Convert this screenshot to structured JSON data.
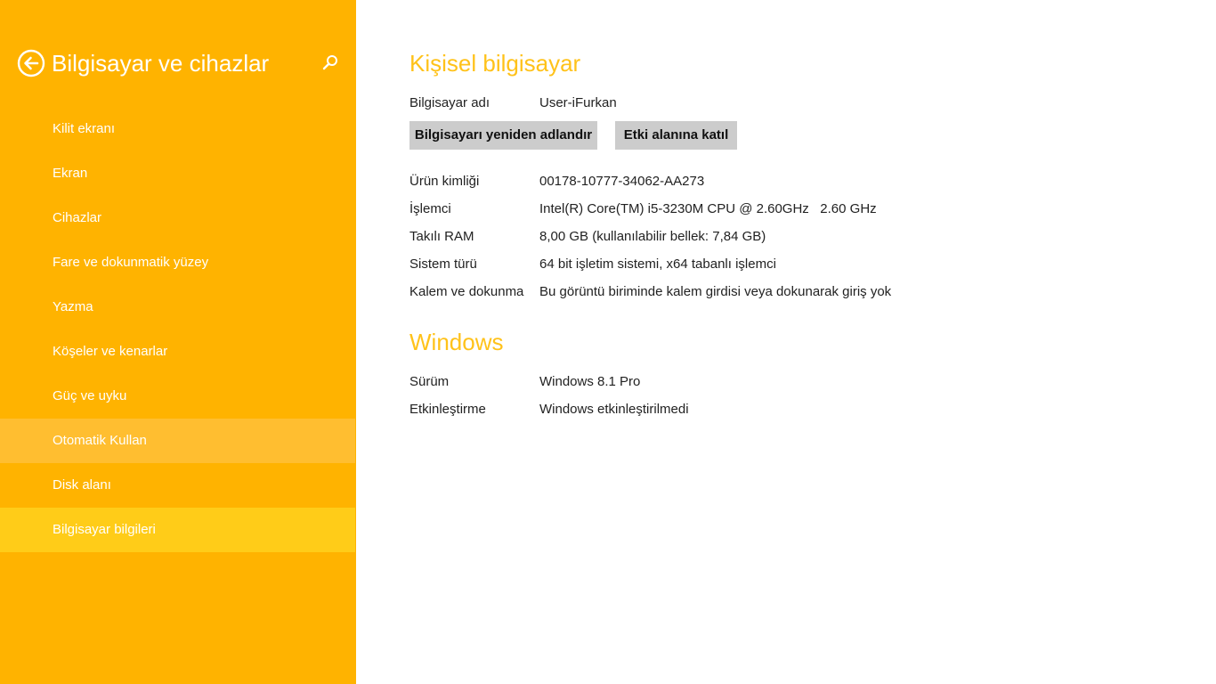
{
  "sidebar": {
    "title": "Bilgisayar ve cihazlar",
    "back_icon": "back-arrow-circle-icon",
    "search_icon": "search-icon",
    "items": [
      {
        "label": "Kilit ekranı"
      },
      {
        "label": "Ekran"
      },
      {
        "label": "Cihazlar"
      },
      {
        "label": "Fare ve dokunmatik yüzey"
      },
      {
        "label": "Yazma"
      },
      {
        "label": "Köşeler ve kenarlar"
      },
      {
        "label": "Güç ve uyku"
      },
      {
        "label": "Otomatik Kullan"
      },
      {
        "label": "Disk alanı"
      },
      {
        "label": "Bilgisayar bilgileri"
      }
    ],
    "hovered_item": "Otomatik Kullan",
    "selected_item": "Bilgisayar bilgileri"
  },
  "pc_section": {
    "title": "Kişisel bilgisayar",
    "computer_name_label": "Bilgisayar adı",
    "computer_name_value": "User-iFurkan",
    "rename_button": "Bilgisayarı yeniden adlandır",
    "join_domain_button": "Etki alanına katıl",
    "properties": [
      {
        "label": "Ürün kimliği",
        "value": "00178-10777-34062-AA273"
      },
      {
        "label": "İşlemci",
        "value": "Intel(R) Core(TM) i5-3230M CPU @ 2.60GHz   2.60 GHz"
      },
      {
        "label": "Takılı RAM",
        "value": "8,00 GB (kullanılabilir bellek: 7,84 GB)"
      },
      {
        "label": "Sistem türü",
        "value": "64 bit işletim sistemi, x64 tabanlı işlemci"
      },
      {
        "label": "Kalem ve dokunma",
        "value": "Bu görüntü biriminde kalem girdisi veya dokunarak giriş yok"
      }
    ]
  },
  "windows_section": {
    "title": "Windows",
    "properties": [
      {
        "label": "Sürüm",
        "value": "Windows 8.1 Pro"
      },
      {
        "label": "Etkinleştirme",
        "value": "Windows etkinleştirilmedi"
      }
    ]
  },
  "colors": {
    "sidebar_bg": "#FFB300",
    "sidebar_hover": "#FFBE30",
    "sidebar_selected": "#FFCC18",
    "accent_title": "#FFC21A",
    "button_bg": "#CCCCCC"
  }
}
